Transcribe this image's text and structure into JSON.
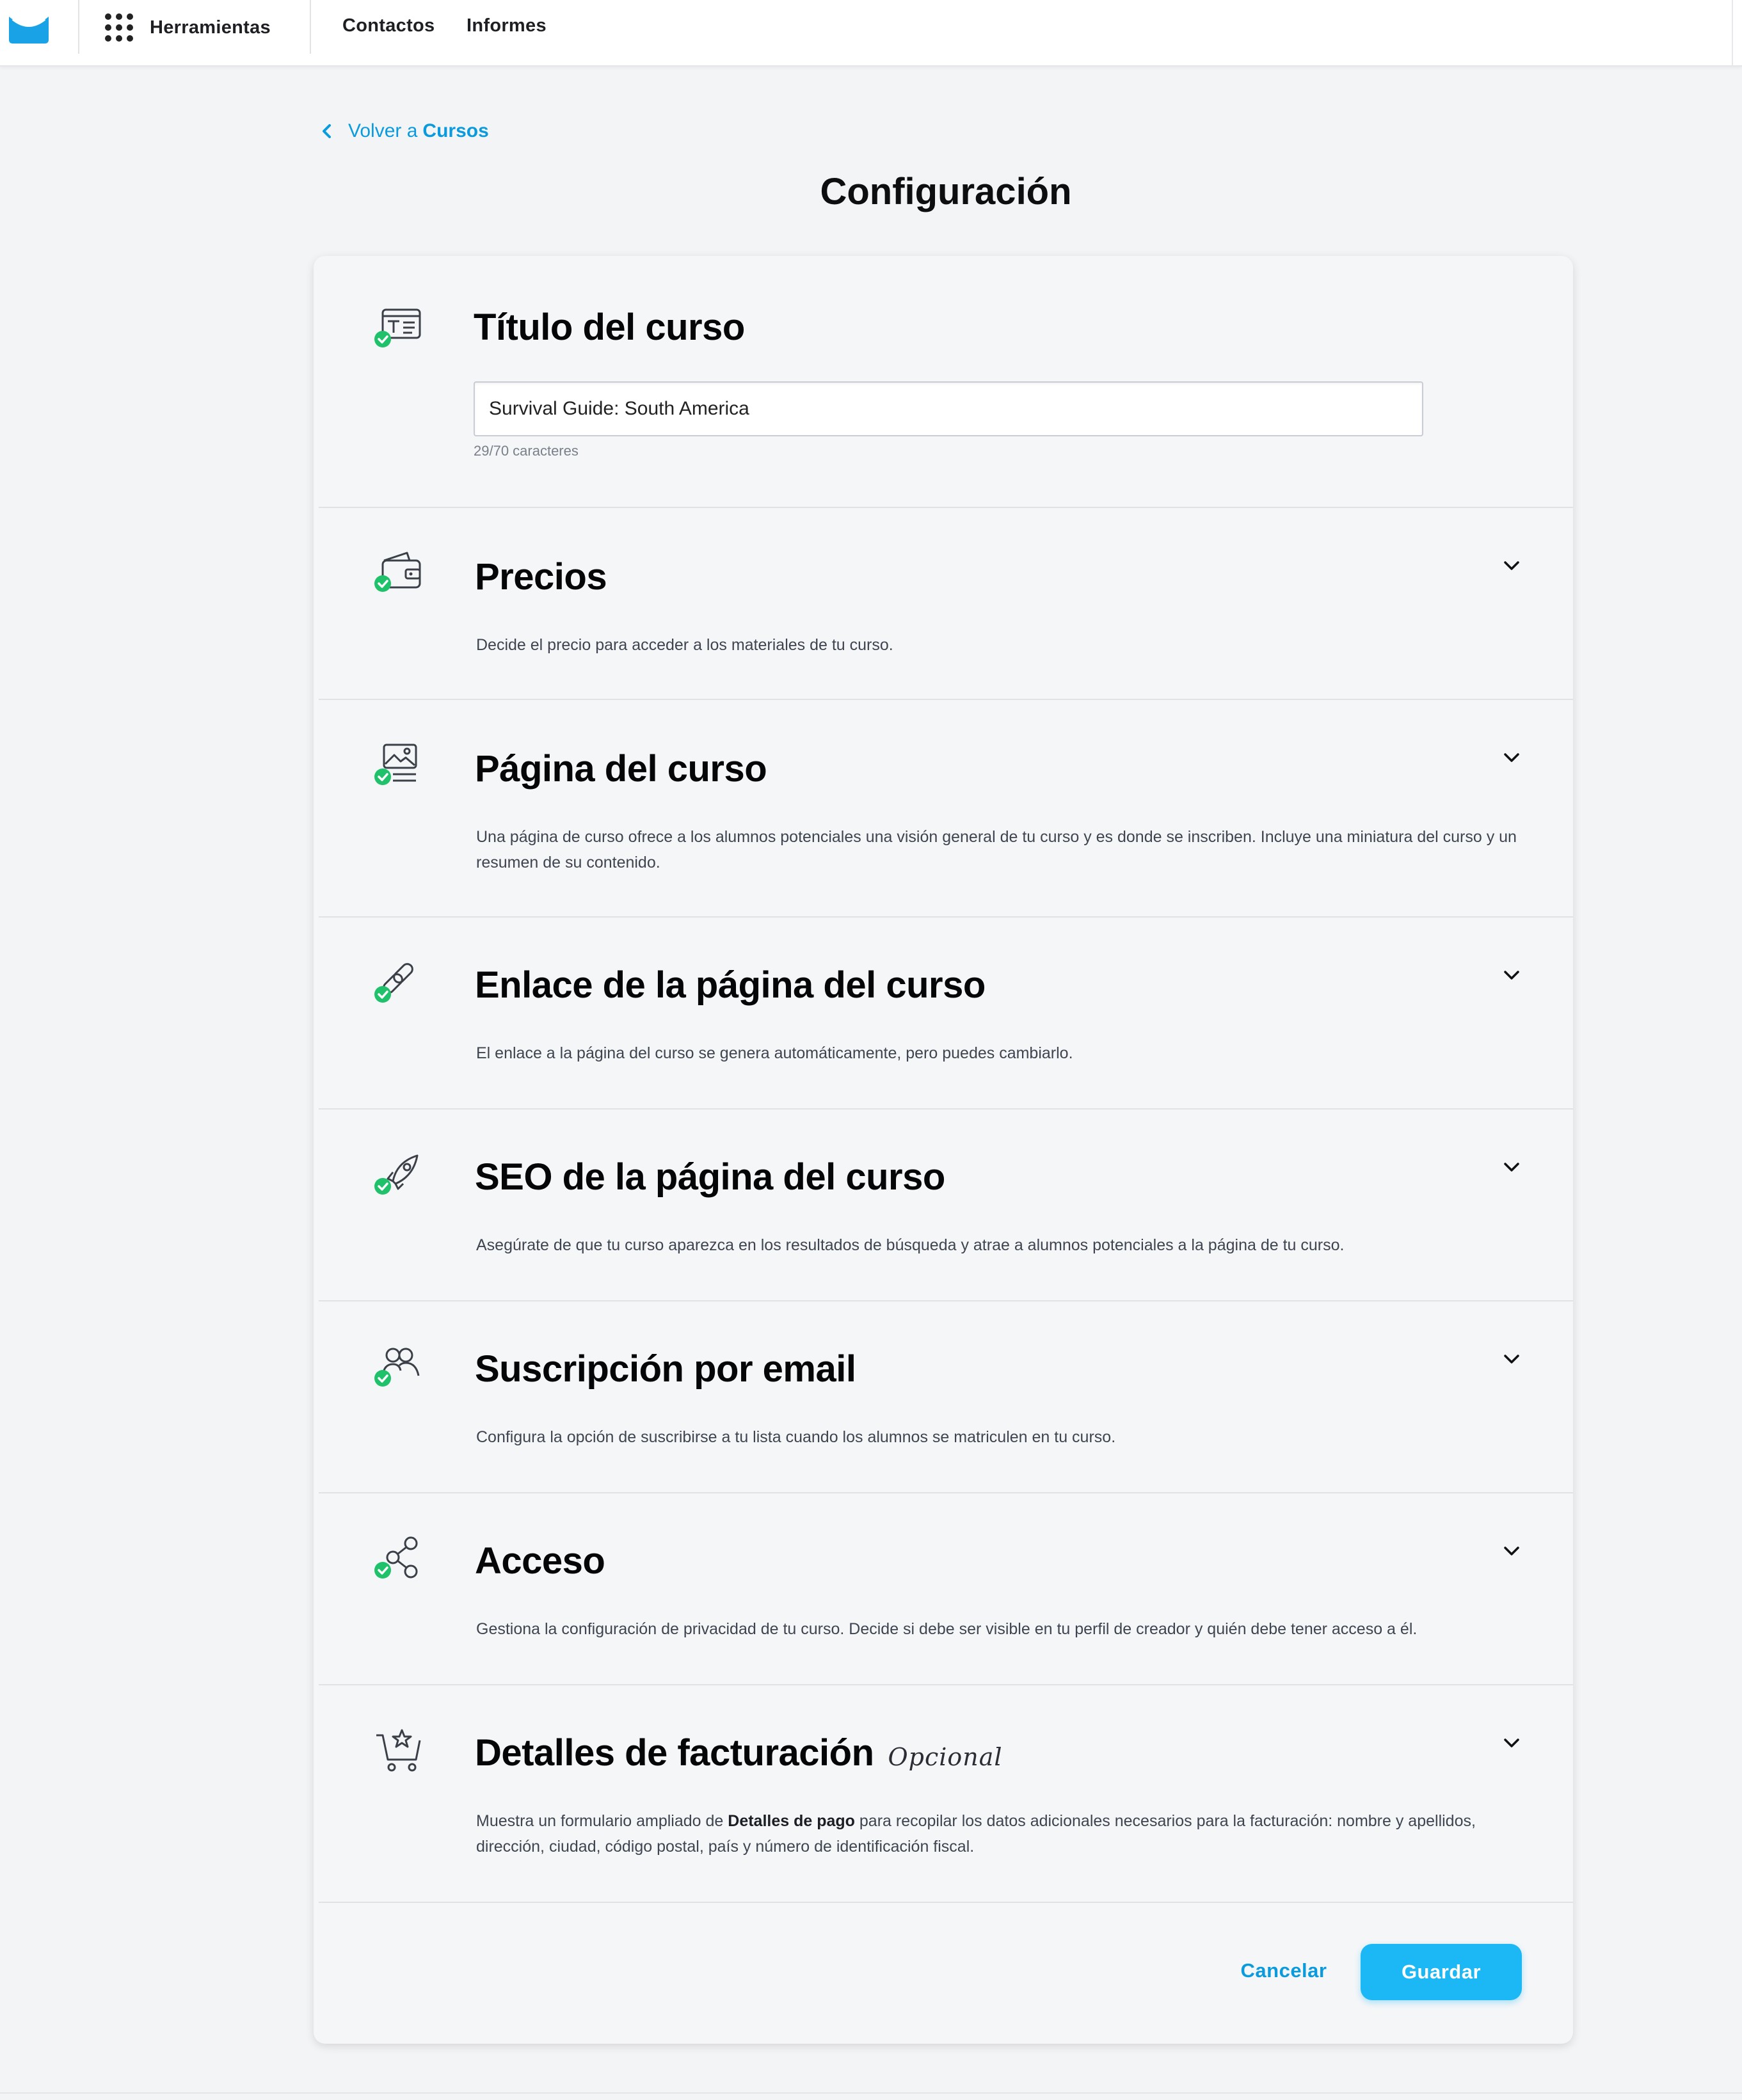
{
  "colors": {
    "accent": "#0b9bdd",
    "save_button": "#1bb8f5",
    "check_green": "#1fc16b",
    "background": "#f3f4f6"
  },
  "nav": {
    "tools_label": "Herramientas",
    "contacts_label": "Contactos",
    "reports_label": "Informes"
  },
  "back": {
    "prefix": "Volver a",
    "target": "Cursos"
  },
  "page_title": "Configuración",
  "course_title": {
    "heading": "Título del curso",
    "value": "Survival Guide: South America",
    "counter": "29/70 caracteres"
  },
  "sections": [
    {
      "icon": "course-title-icon",
      "title": "Precios",
      "description": "Decide el precio para acceder a los materiales de tu curso.",
      "icon_name": "wallet-icon"
    },
    {
      "title": "Página del curso",
      "description": "Una página de curso ofrece a los alumnos potenciales una visión general de tu curso y es donde se inscriben. Incluye una miniatura del curso y un resumen de su contenido.",
      "icon_name": "page-image-icon"
    },
    {
      "title": "Enlace de la página del curso",
      "description": "El enlace a la página del curso se genera automáticamente, pero puedes cambiarlo.",
      "icon_name": "link-icon"
    },
    {
      "title": "SEO de la página del curso",
      "description": "Asegúrate de que tu curso aparezca en los resultados de búsqueda y atrae a alumnos potenciales a la página de tu curso.",
      "icon_name": "rocket-icon"
    },
    {
      "title": "Suscripción por email",
      "description": "Configura la opción de suscribirse a tu lista cuando los alumnos se matriculen en tu curso.",
      "icon_name": "people-icon"
    },
    {
      "title": "Acceso",
      "description": "Gestiona la configuración de privacidad de tu curso. Decide si debe ser visible en tu perfil de creador y quién debe tener acceso a él.",
      "icon_name": "share-icon"
    },
    {
      "title": "Detalles de facturación",
      "optional": "Opcional",
      "description_before": "Muestra un formulario ampliado de",
      "description_bold": "Detalles de pago",
      "description_after": "para recopilar los datos adicionales necesarios para la facturación: nombre y apellidos, dirección, ciudad, código postal, país y número de identificación fiscal.",
      "icon_name": "cart-star-icon"
    }
  ],
  "footer": {
    "cancel_label": "Cancelar",
    "save_label": "Guardar"
  }
}
